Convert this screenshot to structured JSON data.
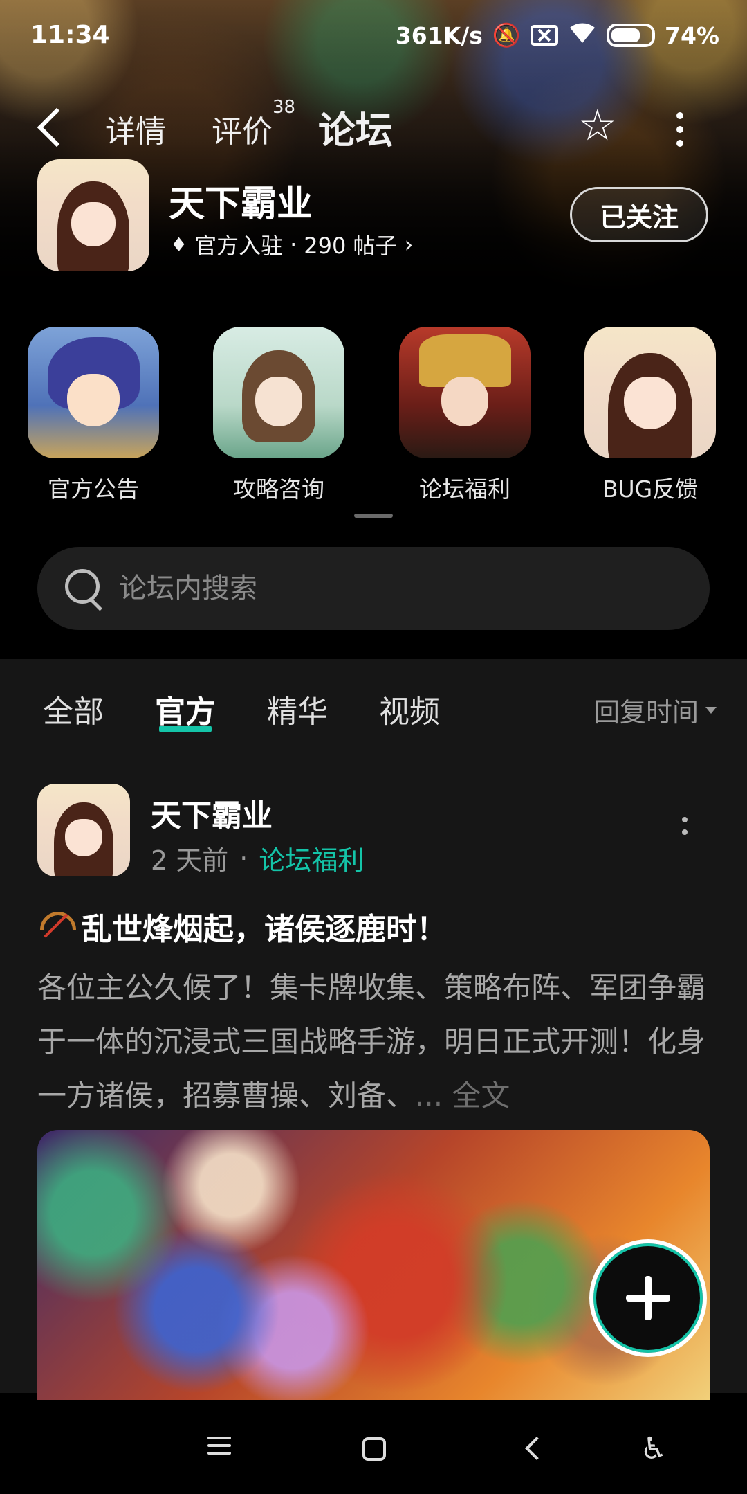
{
  "status_bar": {
    "time": "11:34",
    "net_speed": "361K/s",
    "battery": "74%"
  },
  "nav": {
    "tabs": [
      {
        "label": "详情"
      },
      {
        "label": "评价",
        "badge": "38"
      },
      {
        "label": "论坛"
      }
    ],
    "active_tab": "论坛"
  },
  "game": {
    "name": "天下霸业",
    "verified": "官方入驻",
    "separator": "·",
    "posts": "290 帖子",
    "follow_label": "已关注"
  },
  "categories": [
    {
      "label": "官方公告",
      "icon": "blue-hair-hero-avatar"
    },
    {
      "label": "攻略咨询",
      "icon": "archer-girl-avatar"
    },
    {
      "label": "论坛福利",
      "icon": "warlord-avatar"
    },
    {
      "label": "BUG反馈",
      "icon": "princess-avatar"
    }
  ],
  "search": {
    "placeholder": "论坛内搜索"
  },
  "filters": {
    "tabs": [
      "全部",
      "官方",
      "精华",
      "视频"
    ],
    "active": "官方",
    "sort": "回复时间"
  },
  "post": {
    "author": "天下霸业",
    "time": "2 天前",
    "separator": "·",
    "subforum": "论坛福利",
    "title": "乱世烽烟起，诸侯逐鹿时！",
    "body": "各位主公久候了！集卡牌收集、策略布阵、军团争霸于一体的沉浸式三国战略手游，明日正式开测！化身一方诸侯，招募曹操、刘备、",
    "more": "... 全文"
  },
  "colors": {
    "accent": "#14c4a8",
    "background": "#161616"
  }
}
